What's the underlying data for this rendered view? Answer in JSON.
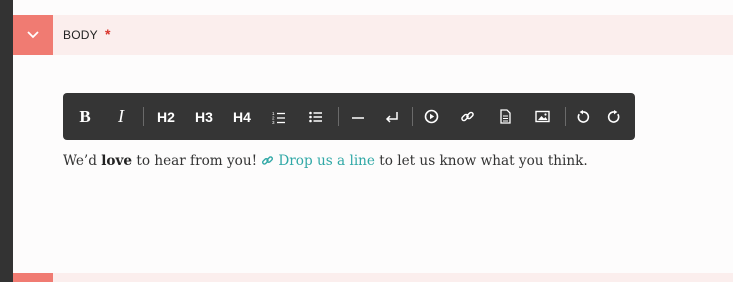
{
  "field": {
    "label": "BODY",
    "required_mark": "*"
  },
  "toolbar": {
    "bold": "B",
    "italic": "I",
    "h2": "H2",
    "h3": "H3",
    "h4": "H4",
    "icons": [
      "bold",
      "italic",
      "h2",
      "h3",
      "h4",
      "ordered-list-icon",
      "unordered-list-icon",
      "horizontal-rule-icon",
      "line-break-icon",
      "embed-video-icon",
      "link-icon",
      "file-icon",
      "image-icon",
      "undo-icon",
      "redo-icon"
    ]
  },
  "content": {
    "before": "We’d ",
    "bold": "love",
    "middle": " to hear from you! ",
    "link_text": "Drop us a line",
    "after": " to let us know what you think."
  },
  "colors": {
    "header_bg": "#fbeeed",
    "collapse_button": "#f07b72",
    "toolbar_bg": "#353535",
    "link": "#30a8a6",
    "required": "#d9342b",
    "rail": "#333333"
  }
}
